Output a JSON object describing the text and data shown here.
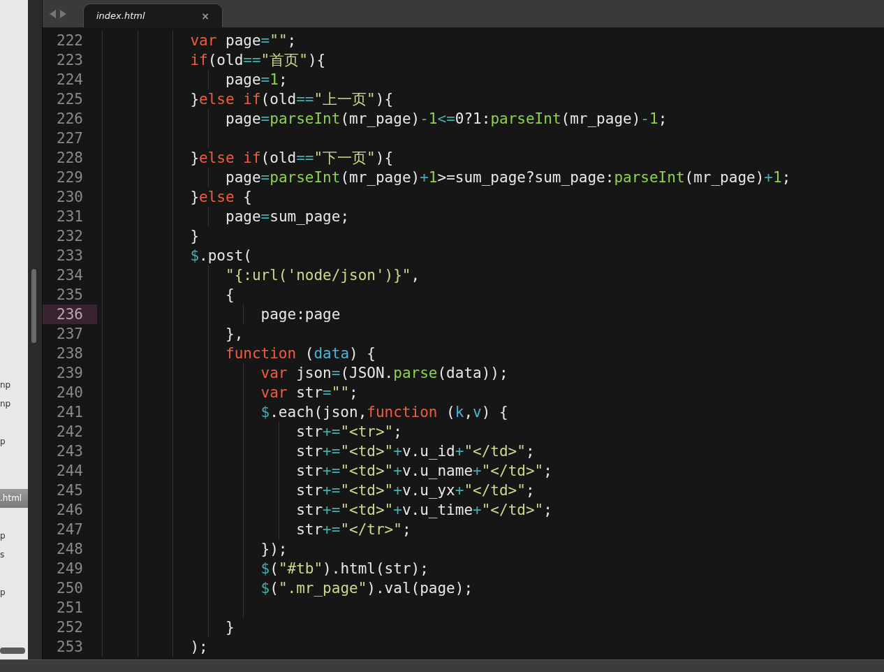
{
  "sidebar": {
    "items": [
      {
        "label": "np",
        "selected": false
      },
      {
        "label": "np",
        "selected": false
      },
      {
        "label": "p",
        "selected": false
      },
      {
        "label": ".html",
        "selected": true
      },
      {
        "label": "p",
        "selected": false
      },
      {
        "label": "s",
        "selected": false
      },
      {
        "label": "p",
        "selected": false
      }
    ]
  },
  "tabs": [
    {
      "label": "index.html",
      "close": "×",
      "selected": true
    }
  ],
  "editor": {
    "lines": [
      {
        "number": "222",
        "current": false,
        "tokens": [
          {
            "kind": "kw",
            "text": "var"
          },
          {
            "kind": "plain",
            "text": " page"
          },
          {
            "kind": "op",
            "text": "="
          },
          {
            "kind": "str",
            "text": "\"\""
          },
          {
            "kind": "plain",
            "text": ";"
          }
        ]
      },
      {
        "number": "223",
        "current": false,
        "tokens": [
          {
            "kind": "kw",
            "text": "if"
          },
          {
            "kind": "plain",
            "text": "(old"
          },
          {
            "kind": "op",
            "text": "=="
          },
          {
            "kind": "str",
            "text": "\"首页\""
          },
          {
            "kind": "plain",
            "text": "){"
          }
        ],
        "children": [
          {
            "number": "224",
            "current": false,
            "tokens": [
              {
                "kind": "plain",
                "text": "page"
              },
              {
                "kind": "op",
                "text": "="
              },
              {
                "kind": "num",
                "text": "1"
              },
              {
                "kind": "plain",
                "text": ";"
              }
            ]
          }
        ]
      },
      {
        "number": "225",
        "current": false,
        "tokens": [
          {
            "kind": "plain",
            "text": "}"
          },
          {
            "kind": "kw",
            "text": "else if"
          },
          {
            "kind": "plain",
            "text": "(old"
          },
          {
            "kind": "op",
            "text": "=="
          },
          {
            "kind": "str",
            "text": "\"上一页\""
          },
          {
            "kind": "plain",
            "text": "){"
          }
        ],
        "children": [
          {
            "number": "226",
            "current": false,
            "tokens": [
              {
                "kind": "plain",
                "text": "page"
              },
              {
                "kind": "op",
                "text": "="
              },
              {
                "kind": "fn",
                "text": "parseInt"
              },
              {
                "kind": "plain",
                "text": "(mr_page)"
              },
              {
                "kind": "op",
                "text": "-"
              },
              {
                "kind": "num",
                "text": "1"
              },
              {
                "kind": "op",
                "text": "<="
              },
              {
                "kind": "plain",
                "text": "0?1:"
              },
              {
                "kind": "fn",
                "text": "parseInt"
              },
              {
                "kind": "plain",
                "text": "(mr_page)"
              },
              {
                "kind": "op",
                "text": "-"
              },
              {
                "kind": "num",
                "text": "1"
              },
              {
                "kind": "plain",
                "text": ";"
              }
            ]
          },
          {
            "number": "227",
            "current": false
          }
        ]
      },
      {
        "number": "228",
        "current": false,
        "tokens": [
          {
            "kind": "plain",
            "text": "}"
          },
          {
            "kind": "kw",
            "text": "else if"
          },
          {
            "kind": "plain",
            "text": "(old"
          },
          {
            "kind": "op",
            "text": "=="
          },
          {
            "kind": "str",
            "text": "\"下一页\""
          },
          {
            "kind": "plain",
            "text": "){"
          }
        ],
        "children": [
          {
            "number": "229",
            "current": false,
            "tokens": [
              {
                "kind": "plain",
                "text": "page"
              },
              {
                "kind": "op",
                "text": "="
              },
              {
                "kind": "fn",
                "text": "parseInt"
              },
              {
                "kind": "plain",
                "text": "(mr_page)"
              },
              {
                "kind": "op",
                "text": "+"
              },
              {
                "kind": "num",
                "text": "1"
              },
              {
                "kind": "plain",
                "text": ">=sum_page?sum_page:"
              },
              {
                "kind": "fn",
                "text": "parseInt"
              },
              {
                "kind": "plain",
                "text": "(mr_page)"
              },
              {
                "kind": "op",
                "text": "+"
              },
              {
                "kind": "num",
                "text": "1"
              },
              {
                "kind": "plain",
                "text": ";"
              }
            ]
          }
        ]
      },
      {
        "number": "230",
        "current": false,
        "tokens": [
          {
            "kind": "plain",
            "text": "}"
          },
          {
            "kind": "kw",
            "text": "else"
          },
          {
            "kind": "plain",
            "text": " {"
          }
        ],
        "children": [
          {
            "number": "231",
            "current": false,
            "tokens": [
              {
                "kind": "plain",
                "text": "page"
              },
              {
                "kind": "op",
                "text": "="
              },
              {
                "kind": "plain",
                "text": "sum_page;"
              }
            ]
          }
        ]
      },
      {
        "number": "232",
        "current": false,
        "tokens": [
          {
            "kind": "plain",
            "text": "}"
          }
        ]
      },
      {
        "number": "233",
        "current": false,
        "tokens": [
          {
            "kind": "op",
            "text": "$"
          },
          {
            "kind": "plain",
            "text": ".post("
          }
        ],
        "children": [
          {
            "number": "234",
            "current": false,
            "tokens": [
              {
                "kind": "str",
                "text": "\"{:url('node/json')}\""
              },
              {
                "kind": "plain",
                "text": ","
              }
            ]
          },
          {
            "number": "235",
            "current": false,
            "tokens": [
              {
                "kind": "plain",
                "text": "{"
              }
            ],
            "children": [
              {
                "number": "236",
                "current": true,
                "tokens": [
                  {
                    "kind": "plain",
                    "text": "page:page"
                  }
                ]
              }
            ]
          },
          {
            "number": "237",
            "current": false,
            "tokens": [
              {
                "kind": "plain",
                "text": "},"
              }
            ]
          },
          {
            "number": "238",
            "current": false,
            "tokens": [
              {
                "kind": "kw",
                "text": "function"
              },
              {
                "kind": "plain",
                "text": " ("
              },
              {
                "kind": "param",
                "text": "data"
              },
              {
                "kind": "plain",
                "text": ") {"
              }
            ],
            "children": [
              {
                "number": "239",
                "current": false,
                "tokens": [
                  {
                    "kind": "kw",
                    "text": "var"
                  },
                  {
                    "kind": "plain",
                    "text": " json"
                  },
                  {
                    "kind": "op",
                    "text": "="
                  },
                  {
                    "kind": "plain",
                    "text": "(JSON."
                  },
                  {
                    "kind": "fn",
                    "text": "parse"
                  },
                  {
                    "kind": "plain",
                    "text": "(data));"
                  }
                ]
              },
              {
                "number": "240",
                "current": false,
                "tokens": [
                  {
                    "kind": "kw",
                    "text": "var"
                  },
                  {
                    "kind": "plain",
                    "text": " str"
                  },
                  {
                    "kind": "op",
                    "text": "="
                  },
                  {
                    "kind": "str",
                    "text": "\"\""
                  },
                  {
                    "kind": "plain",
                    "text": ";"
                  }
                ]
              },
              {
                "number": "241",
                "current": false,
                "tokens": [
                  {
                    "kind": "op",
                    "text": "$"
                  },
                  {
                    "kind": "plain",
                    "text": ".each(json,"
                  },
                  {
                    "kind": "kw",
                    "text": "function"
                  },
                  {
                    "kind": "plain",
                    "text": " ("
                  },
                  {
                    "kind": "param",
                    "text": "k"
                  },
                  {
                    "kind": "plain",
                    "text": ","
                  },
                  {
                    "kind": "param",
                    "text": "v"
                  },
                  {
                    "kind": "plain",
                    "text": ") {"
                  }
                ],
                "children": [
                  {
                    "number": "242",
                    "current": false,
                    "tokens": [
                      {
                        "kind": "plain",
                        "text": "str"
                      },
                      {
                        "kind": "op",
                        "text": "+="
                      },
                      {
                        "kind": "str",
                        "text": "\"<tr>\""
                      },
                      {
                        "kind": "plain",
                        "text": ";"
                      }
                    ]
                  },
                  {
                    "number": "243",
                    "current": false,
                    "tokens": [
                      {
                        "kind": "plain",
                        "text": "str"
                      },
                      {
                        "kind": "op",
                        "text": "+="
                      },
                      {
                        "kind": "str",
                        "text": "\"<td>\""
                      },
                      {
                        "kind": "op",
                        "text": "+"
                      },
                      {
                        "kind": "plain",
                        "text": "v.u_id"
                      },
                      {
                        "kind": "op",
                        "text": "+"
                      },
                      {
                        "kind": "str",
                        "text": "\"</td>\""
                      },
                      {
                        "kind": "plain",
                        "text": ";"
                      }
                    ]
                  },
                  {
                    "number": "244",
                    "current": false,
                    "tokens": [
                      {
                        "kind": "plain",
                        "text": "str"
                      },
                      {
                        "kind": "op",
                        "text": "+="
                      },
                      {
                        "kind": "str",
                        "text": "\"<td>\""
                      },
                      {
                        "kind": "op",
                        "text": "+"
                      },
                      {
                        "kind": "plain",
                        "text": "v.u_name"
                      },
                      {
                        "kind": "op",
                        "text": "+"
                      },
                      {
                        "kind": "str",
                        "text": "\"</td>\""
                      },
                      {
                        "kind": "plain",
                        "text": ";"
                      }
                    ]
                  },
                  {
                    "number": "245",
                    "current": false,
                    "tokens": [
                      {
                        "kind": "plain",
                        "text": "str"
                      },
                      {
                        "kind": "op",
                        "text": "+="
                      },
                      {
                        "kind": "str",
                        "text": "\"<td>\""
                      },
                      {
                        "kind": "op",
                        "text": "+"
                      },
                      {
                        "kind": "plain",
                        "text": "v.u_yx"
                      },
                      {
                        "kind": "op",
                        "text": "+"
                      },
                      {
                        "kind": "str",
                        "text": "\"</td>\""
                      },
                      {
                        "kind": "plain",
                        "text": ";"
                      }
                    ]
                  },
                  {
                    "number": "246",
                    "current": false,
                    "tokens": [
                      {
                        "kind": "plain",
                        "text": "str"
                      },
                      {
                        "kind": "op",
                        "text": "+="
                      },
                      {
                        "kind": "str",
                        "text": "\"<td>\""
                      },
                      {
                        "kind": "op",
                        "text": "+"
                      },
                      {
                        "kind": "plain",
                        "text": "v.u_time"
                      },
                      {
                        "kind": "op",
                        "text": "+"
                      },
                      {
                        "kind": "str",
                        "text": "\"</td>\""
                      },
                      {
                        "kind": "plain",
                        "text": ";"
                      }
                    ]
                  },
                  {
                    "number": "247",
                    "current": false,
                    "tokens": [
                      {
                        "kind": "plain",
                        "text": "str"
                      },
                      {
                        "kind": "op",
                        "text": "+="
                      },
                      {
                        "kind": "str",
                        "text": "\"</tr>\""
                      },
                      {
                        "kind": "plain",
                        "text": ";"
                      }
                    ]
                  }
                ]
              },
              {
                "number": "248",
                "current": false,
                "tokens": [
                  {
                    "kind": "plain",
                    "text": "});"
                  }
                ]
              },
              {
                "number": "249",
                "current": false,
                "tokens": [
                  {
                    "kind": "op",
                    "text": "$"
                  },
                  {
                    "kind": "plain",
                    "text": "("
                  },
                  {
                    "kind": "str",
                    "text": "\"#tb\""
                  },
                  {
                    "kind": "plain",
                    "text": ").html(str);"
                  }
                ]
              },
              {
                "number": "250",
                "current": false,
                "tokens": [
                  {
                    "kind": "op",
                    "text": "$"
                  },
                  {
                    "kind": "plain",
                    "text": "("
                  },
                  {
                    "kind": "str",
                    "text": "\".mr_page\""
                  },
                  {
                    "kind": "plain",
                    "text": ").val(page);"
                  }
                ]
              },
              {
                "number": "251",
                "current": false
              }
            ]
          },
          {
            "number": "252",
            "current": false,
            "tokens": [
              {
                "kind": "plain",
                "text": "}"
              }
            ]
          }
        ]
      },
      {
        "number": "253",
        "current": false,
        "tokens": [
          {
            "kind": "plain",
            "text": ");"
          }
        ]
      }
    ]
  }
}
